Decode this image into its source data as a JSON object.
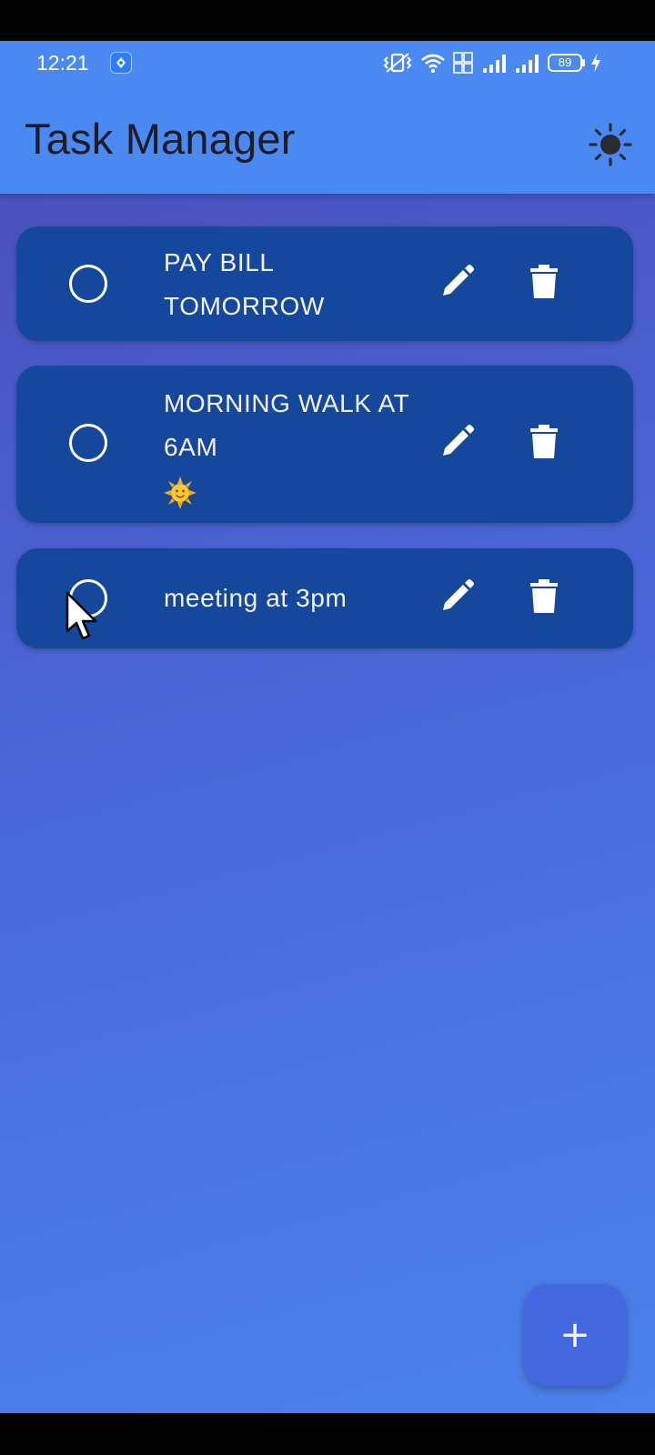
{
  "status_bar": {
    "time": "12:21",
    "battery": "89",
    "icons": [
      "app-notification-icon",
      "vibrate-icon",
      "wifi-icon",
      "volte-icon",
      "signal-1-icon",
      "signal-2-icon",
      "battery-icon",
      "charging-icon"
    ]
  },
  "app": {
    "title": "Task Manager",
    "theme_toggle_icon": "sun-icon"
  },
  "tasks": [
    {
      "title": "PAY BILL TOMORROW",
      "completed": false
    },
    {
      "title": "MORNING WALK AT 6AM",
      "emoji": "sun-face-emoji",
      "completed": false
    },
    {
      "title": "meeting at 3pm",
      "completed": false
    }
  ],
  "fab": {
    "label": "+",
    "icon": "add-icon"
  },
  "colors": {
    "header": "#4a88f2",
    "card": "#15479c",
    "fab": "#4468df",
    "title_text": "#1d1d2a"
  }
}
